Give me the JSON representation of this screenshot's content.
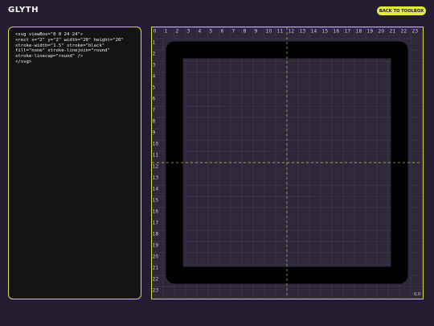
{
  "app": {
    "logo": "GLYTH",
    "back_button": "BACK TO TOOLBOX"
  },
  "code": {
    "lines": [
      "<svg viewBox=\"0 0 24 24\">",
      "<rect x=\"2\" y=\"2\" width=\"20\" height=\"20\"",
      "stroke-width=\"1.5\" stroke=\"black\"",
      "fill=\"none\" stroke-linejoin=\"round\"",
      "stroke-linecap=\"round\" />",
      "</svg>"
    ]
  },
  "canvas": {
    "ruler_labels": [
      "0",
      "1",
      "2",
      "3",
      "4",
      "5",
      "6",
      "7",
      "8",
      "9",
      "10",
      "11",
      "12",
      "13",
      "14",
      "15",
      "16",
      "17",
      "18",
      "19",
      "20",
      "21",
      "22",
      "23"
    ],
    "zoom_readout": "0,0",
    "accent_color": "#e6ec3a",
    "grid_color": "#4a3f5c"
  }
}
